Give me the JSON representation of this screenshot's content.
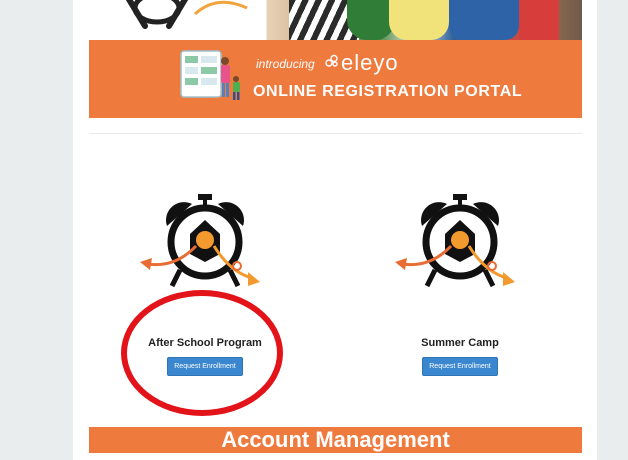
{
  "banner": {
    "introducing": "introducing",
    "brand": "eleyo",
    "portal_title": "ONLINE REGISTRATION PORTAL"
  },
  "programs": [
    {
      "title": "After School Program",
      "button_label": "Request Enrollment",
      "icon": "alarm-clock-icon"
    },
    {
      "title": "Summer Camp",
      "button_label": "Request Enrollment",
      "icon": "alarm-clock-icon"
    }
  ],
  "account_bar": {
    "title": "Account Management"
  },
  "colors": {
    "accent_orange": "#ef7a3d",
    "button_blue": "#3a87cf",
    "highlight_red": "#e3131a"
  }
}
